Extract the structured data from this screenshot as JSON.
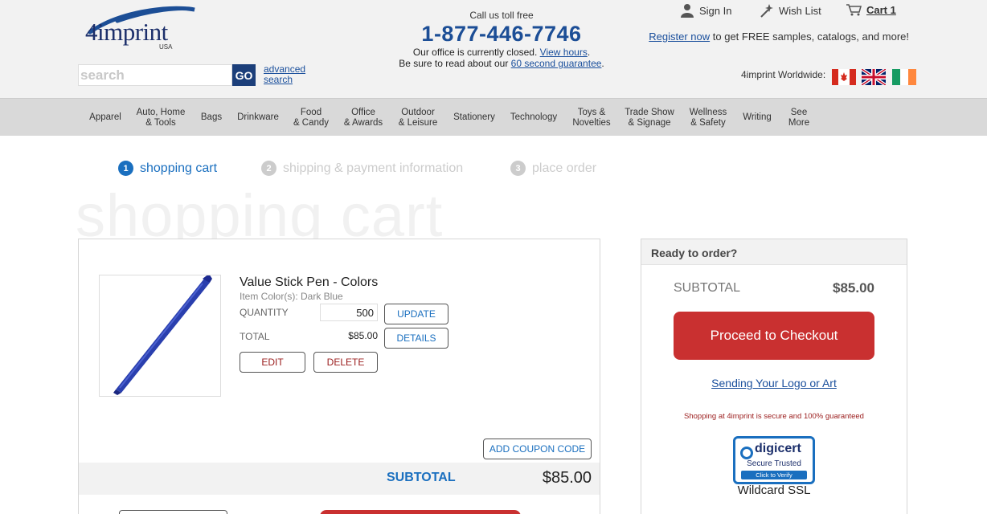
{
  "header": {
    "logo_text": "4imprint",
    "logo_sub": "USA",
    "search_placeholder": "search",
    "go_label": "GO",
    "advanced_search": "advanced search",
    "call_label": "Call us toll free",
    "phone": "1-877-446-7746",
    "closed_text": "Our office is currently closed.",
    "view_hours": "View hours",
    "guarantee_prefix": "Be sure to read about our",
    "guarantee_link": "60 second guarantee",
    "sign_in": "Sign In",
    "wish_list": "Wish List",
    "cart_label": "Cart 1",
    "register_link": "Register now",
    "register_text": "to get FREE samples, catalogs, and more!",
    "worldwide": "4imprint Worldwide:",
    "icons": [
      "person-icon",
      "wand-icon",
      "cart-icon"
    ],
    "flags": [
      "canada-flag-icon",
      "uk-flag-icon",
      "ireland-flag-icon"
    ]
  },
  "nav": {
    "items": [
      {
        "line1": "Apparel",
        "line2": ""
      },
      {
        "line1": "Auto, Home",
        "line2": "& Tools"
      },
      {
        "line1": "Bags",
        "line2": ""
      },
      {
        "line1": "Drinkware",
        "line2": ""
      },
      {
        "line1": "Food",
        "line2": "& Candy"
      },
      {
        "line1": "Office",
        "line2": "& Awards"
      },
      {
        "line1": "Outdoor",
        "line2": "& Leisure"
      },
      {
        "line1": "Stationery",
        "line2": ""
      },
      {
        "line1": "Technology",
        "line2": ""
      },
      {
        "line1": "Toys &",
        "line2": "Novelties"
      },
      {
        "line1": "Trade Show",
        "line2": "& Signage"
      },
      {
        "line1": "Wellness",
        "line2": "& Safety"
      },
      {
        "line1": "Writing",
        "line2": ""
      },
      {
        "line1": "See",
        "line2": "More"
      }
    ]
  },
  "steps": [
    {
      "num": "1",
      "label": "shopping cart"
    },
    {
      "num": "2",
      "label": "shipping & payment information"
    },
    {
      "num": "3",
      "label": "place order"
    }
  ],
  "page_title": "shopping cart",
  "cart": {
    "product_name": "Value Stick Pen - Colors",
    "item_color": "Item Color(s): Dark Blue",
    "quantity_label": "QUANTITY",
    "quantity_value": "500",
    "total_label": "TOTAL",
    "total_value": "$85.00",
    "update_btn": "UPDATE",
    "details_btn": "DETAILS",
    "edit_btn": "EDIT",
    "delete_btn": "DELETE",
    "coupon_btn": "ADD COUPON CODE",
    "subtotal_label": "SUBTOTAL",
    "subtotal_value": "$85.00"
  },
  "order": {
    "title": "Ready to order?",
    "subtotal_label": "SUBTOTAL",
    "subtotal_value": "$85.00",
    "checkout_btn": "Proceed to Checkout",
    "logo_link": "Sending Your Logo or Art",
    "secure_text": "Shopping at 4imprint is secure and 100% guaranteed",
    "digicert_name": "digicert",
    "digicert_secure": "Secure  Trusted",
    "digicert_verify": "Click to Verify",
    "ssl_label": "Wildcard SSL"
  },
  "colors": {
    "brand_blue": "#1c4e96",
    "active_step": "#1a6fbf",
    "checkout_red": "#c93030"
  }
}
